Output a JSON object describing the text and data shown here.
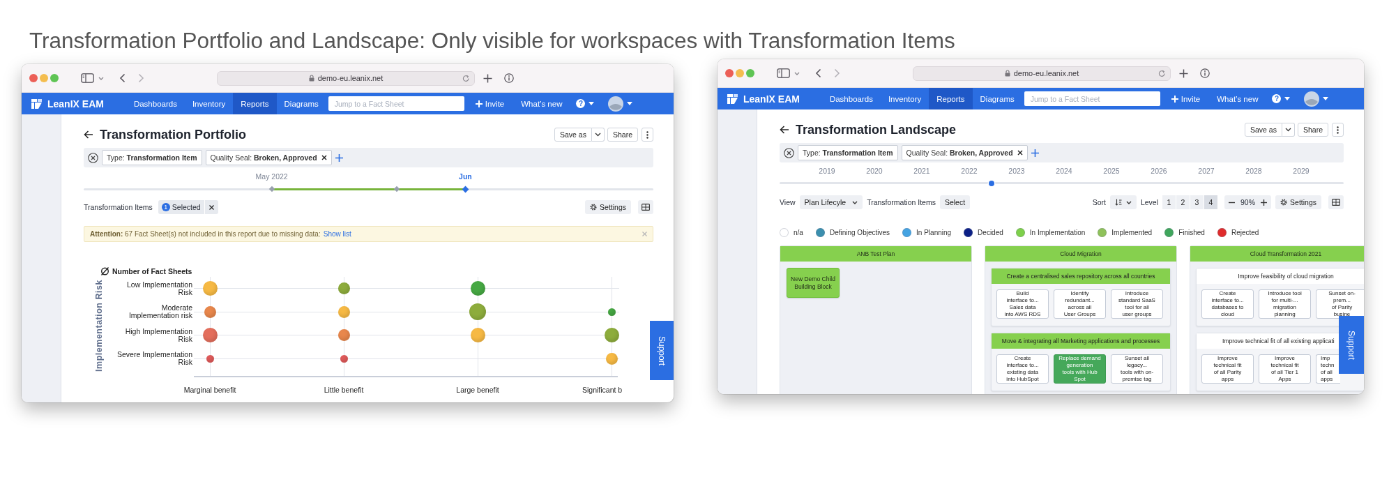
{
  "heading": "Transformation Portfolio and Landscape: Only visible for workspaces with Transformation Items",
  "windows": [
    {
      "kind": "portfolio",
      "url": "demo-eu.leanix.net",
      "nav": {
        "brand": "LeanIX EAM",
        "items": [
          {
            "label": "Dashboards",
            "selected": false
          },
          {
            "label": "Inventory",
            "selected": false
          },
          {
            "label": "Reports",
            "selected": true
          },
          {
            "label": "Diagrams",
            "selected": false
          }
        ],
        "search_placeholder": "Jump to a Fact Sheet",
        "invite": "Invite",
        "whats_new": "What’s new",
        "help": "?"
      },
      "title": "Transformation Portfolio",
      "save": "Save as",
      "share": "Share",
      "filters": [
        {
          "text": "Type: **Transformation Item**",
          "removable": false
        },
        {
          "text": "Quality Seal: **Broken, Approved**",
          "removable": true
        }
      ],
      "handles": [
        {
          "label": "May 2022",
          "level": 0.33,
          "selected": false
        },
        {
          "level": 0.55,
          "selected": false
        },
        {
          "label": "Jun",
          "level": 0.67,
          "selected": true
        }
      ],
      "selection": {
        "label": "Transformation Items",
        "count": "1",
        "chip": "Selected"
      },
      "settings": "Settings",
      "alert": {
        "text": "**Attention:** 67 Fact Sheet(s) not included in this report due to missing data:",
        "link": "Show list"
      },
      "chart": {
        "axis_title": "Implementation Risk",
        "legend": "Number of Fact Sheets",
        "columns": [
          "Marginal benefit",
          "Little benefit",
          "Large benefit",
          "Significant b"
        ],
        "rows": [
          {
            "label": "Low Implementation Risk",
            "bubbles": [
              {
                "kind": "large",
                "color": "#f6b944"
              },
              {
                "kind": "medium",
                "color": "#8dac3c"
              },
              {
                "kind": "large",
                "color": "#46a843"
              },
              {
                "kind": "none"
              }
            ]
          },
          {
            "label": "Moderate Implementation risk",
            "bubbles": [
              {
                "kind": "medium",
                "color": "#e8874c"
              },
              {
                "kind": "medium",
                "color": "#f6b944"
              },
              {
                "kind": "xlarge",
                "color": "#8dac3c"
              },
              {
                "kind": "small",
                "color": "#46a843"
              }
            ]
          },
          {
            "label": "High Implementation Risk",
            "bubbles": [
              {
                "kind": "large",
                "color": "#e36e5c"
              },
              {
                "kind": "medium",
                "color": "#e8874c"
              },
              {
                "kind": "large",
                "color": "#f6b944"
              },
              {
                "kind": "large",
                "color": "#8dac3c"
              }
            ]
          },
          {
            "label": "Severe Implementation Risk",
            "bubbles": [
              {
                "kind": "small",
                "color": "#e15b5b"
              },
              {
                "kind": "small",
                "color": "#e15b5b"
              },
              {
                "kind": "none"
              },
              {
                "kind": "medium",
                "color": "#f6b944"
              }
            ]
          }
        ]
      },
      "support": "Support"
    },
    {
      "kind": "landscape",
      "url": "demo-eu.leanix.net",
      "nav": {
        "brand": "LeanIX EAM",
        "items": [
          {
            "label": "Dashboards",
            "selected": false
          },
          {
            "label": "Inventory",
            "selected": false
          },
          {
            "label": "Reports",
            "selected": true
          },
          {
            "label": "Diagrams",
            "selected": false
          }
        ],
        "search_placeholder": "Jump to a Fact Sheet",
        "invite": "Invite",
        "whats_new": "What’s new",
        "help": "?"
      },
      "title": "Transformation Landscape",
      "save": "Save as",
      "share": "Share",
      "filters": [
        {
          "text": "Type: **Transformation Item**",
          "removable": false
        },
        {
          "text": "Quality Seal: **Broken, Approved**",
          "removable": true
        }
      ],
      "years": [
        "2019",
        "2020",
        "2021",
        "2022",
        "2023",
        "2024",
        "2025",
        "2026",
        "2027",
        "2028",
        "2029"
      ],
      "slider": {
        "level": 0.376
      },
      "toolbar": {
        "view_label": "View",
        "view": "Plan Lifecyle",
        "items_label": "Transformation Items",
        "select": "Select",
        "sort_label": "Sort",
        "level_label": "Level",
        "levels": [
          {
            "label": "1",
            "selected": false
          },
          {
            "label": "2",
            "selected": false
          },
          {
            "label": "3",
            "selected": false
          },
          {
            "label": "4",
            "selected": true
          }
        ],
        "zoom": "90%"
      },
      "settings": "Settings",
      "legend": [
        {
          "label": "n/a",
          "color": "#ffffff"
        },
        {
          "label": "Defining Objectives",
          "color": "#3b8fae"
        },
        {
          "label": "In Planning",
          "color": "#44a3e2"
        },
        {
          "label": "Decided",
          "color": "#0b1f86"
        },
        {
          "label": "In Implementation",
          "color": "#7ed04b"
        },
        {
          "label": "Implemented",
          "color": "#8fc25a"
        },
        {
          "label": "Finished",
          "color": "#3fa65c"
        },
        {
          "label": "Rejected",
          "color": "#e02b2b"
        }
      ],
      "lanes": [
        {
          "title": "ANB Test Plan",
          "color": "#86d04e",
          "cards": [
            {
              "kind": "light",
              "color": "#86d04e",
              "lines": [
                "New Demo Child",
                "Building Block"
              ]
            }
          ]
        },
        {
          "title": "Cloud Migration",
          "color": "#86d04e",
          "groups": [
            {
              "title": "Create a centralised sales repository across all countries",
              "color": "#86d04e",
              "cards": [
                {
                  "kind": "outline",
                  "color": "#ffffff",
                  "lines": [
                    "Build",
                    "interface to...",
                    "Sales data",
                    "into AWS RDS"
                  ]
                },
                {
                  "kind": "outline",
                  "color": "#ffffff",
                  "lines": [
                    "Identify",
                    "redundant...",
                    "across all",
                    "User Groups"
                  ]
                },
                {
                  "kind": "outline",
                  "color": "#ffffff",
                  "lines": [
                    "Introduce",
                    "standard SaaS",
                    "tool for all",
                    "user groups"
                  ]
                }
              ]
            },
            {
              "title": "Move & integrating all Marketing applications and processes",
              "color": "#86d04e",
              "cards": [
                {
                  "kind": "outline",
                  "color": "#ffffff",
                  "lines": [
                    "Create",
                    "interface to...",
                    "existing data",
                    "into HubSpot"
                  ]
                },
                {
                  "kind": "dark",
                  "color": "#45a85a",
                  "lines": [
                    "Replace demand",
                    "generation",
                    "tools with Hub",
                    "Spot"
                  ]
                },
                {
                  "kind": "outline",
                  "color": "#ffffff",
                  "lines": [
                    "Sunset all",
                    "legacy...",
                    "tools with on-",
                    "premise tag"
                  ]
                }
              ]
            }
          ]
        },
        {
          "title": "Cloud Transformation 2021",
          "color": "#86d04e",
          "groups": [
            {
              "title": "Improve feasibility of cloud migration",
              "color": "#ffffff",
              "cards": [
                {
                  "kind": "outline",
                  "color": "#ffffff",
                  "lines": [
                    "Create",
                    "interface to...",
                    "databases to",
                    "cloud"
                  ]
                },
                {
                  "kind": "outline",
                  "color": "#ffffff",
                  "lines": [
                    "Introduce tool",
                    "for multi-...",
                    "migration",
                    "planning"
                  ]
                },
                {
                  "kind": "outline",
                  "color": "#ffffff",
                  "lines": [
                    "Sunset on-",
                    "prem...",
                    "of Parity",
                    "busine"
                  ]
                }
              ]
            },
            {
              "title": "Improve technical fit of all existing applicati",
              "color": "#ffffff",
              "cards": [
                {
                  "kind": "outline",
                  "color": "#ffffff",
                  "lines": [
                    "Improve",
                    "technical fit",
                    "of all Parity",
                    "apps"
                  ]
                },
                {
                  "kind": "outline",
                  "color": "#ffffff",
                  "lines": [
                    "Improve",
                    "technical fit",
                    "of all Tier 1",
                    "Apps"
                  ]
                },
                {
                  "kind": "clipped",
                  "color": "#ffffff",
                  "lines": [
                    "Imp",
                    "techn",
                    "of all",
                    "apps"
                  ]
                }
              ]
            }
          ]
        }
      ],
      "support": "Support"
    }
  ]
}
